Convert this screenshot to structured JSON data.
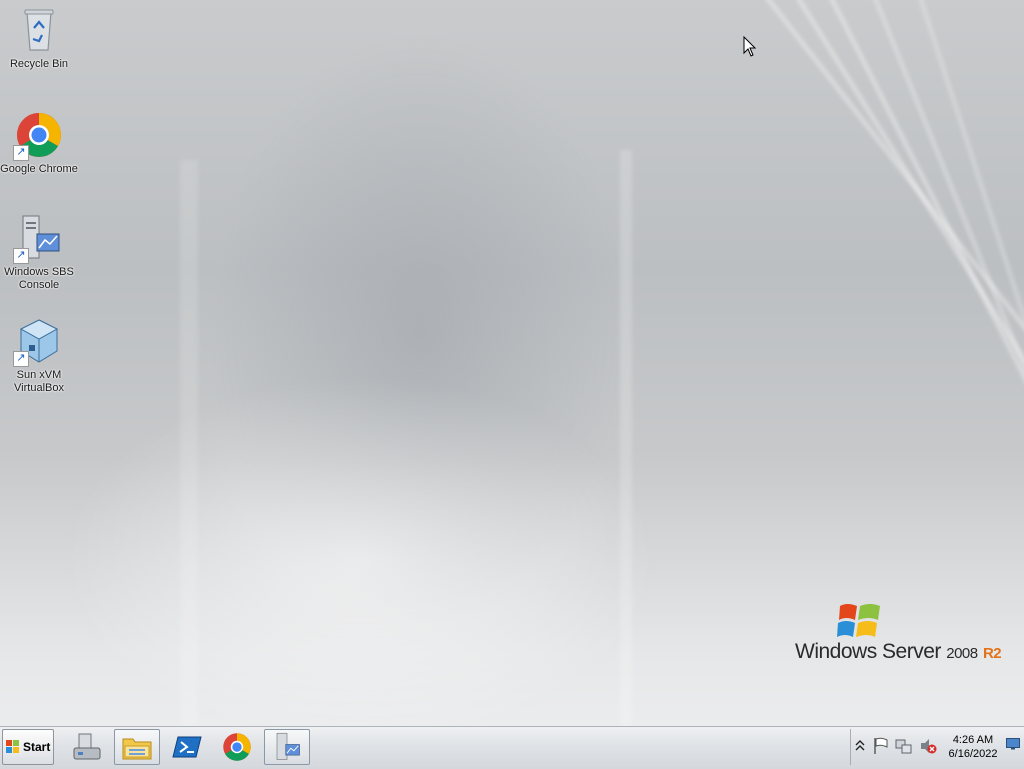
{
  "desktop": {
    "icons": [
      {
        "label": "Recycle Bin",
        "icon": "recycle-bin-icon"
      },
      {
        "label": "Google Chrome",
        "icon": "chrome-icon"
      },
      {
        "label": "Windows SBS Console",
        "icon": "sbs-console-icon"
      },
      {
        "label": "Sun xVM VirtualBox",
        "icon": "virtualbox-icon"
      }
    ],
    "branding": {
      "word": "Windows Server",
      "version": "2008",
      "edition": "R2"
    }
  },
  "taskbar": {
    "start_label": "Start",
    "pinned": [
      {
        "icon": "server-manager-icon"
      },
      {
        "icon": "file-explorer-icon",
        "active": true
      },
      {
        "icon": "powershell-icon"
      },
      {
        "icon": "chrome-icon"
      },
      {
        "icon": "sbs-console-icon",
        "active": true
      }
    ],
    "tray": {
      "icons": [
        "show-hidden-icons-chevron",
        "action-center-flag-icon",
        "network-icon",
        "volume-muted-icon"
      ],
      "time": "4:26 AM",
      "date": "6/16/2022"
    }
  },
  "colors": {
    "accent_orange": "#e2731a",
    "muted_red": "#d62b2b"
  }
}
